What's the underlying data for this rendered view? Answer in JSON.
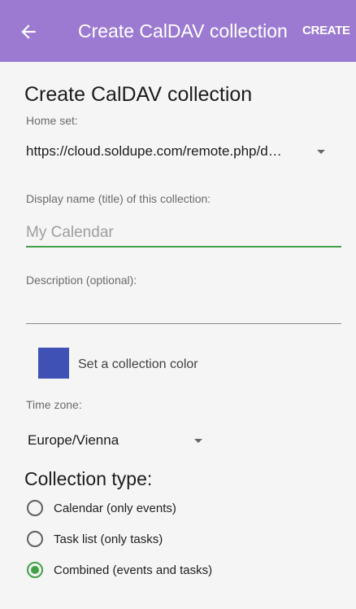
{
  "toolbar": {
    "back_icon": "arrow-left-icon",
    "title": "Create CalDAV collection",
    "action_label": "CREATE",
    "background_color": "#9c7ad1"
  },
  "form": {
    "heading": "Create CalDAV collection",
    "home_set": {
      "label": "Home set:",
      "value": "https://cloud.soldupe.com/remote.php/dav/calendars/"
    },
    "display_name": {
      "label": "Display name (title) of this collection:",
      "placeholder": "My Calendar",
      "value": "",
      "underline_color": "#43a047"
    },
    "description": {
      "label": "Description (optional):",
      "placeholder": "",
      "value": ""
    },
    "color": {
      "swatch_color": "#3f51b5",
      "label": "Set a collection color"
    },
    "time_zone": {
      "label": "Time zone:",
      "value": "Europe/Vienna"
    },
    "collection_type": {
      "title": "Collection type:",
      "options": [
        {
          "label": "Calendar (only events)",
          "checked": false
        },
        {
          "label": "Task list (only tasks)",
          "checked": false
        },
        {
          "label": "Combined (events and tasks)",
          "checked": true
        }
      ],
      "accent_color": "#43a047"
    }
  }
}
